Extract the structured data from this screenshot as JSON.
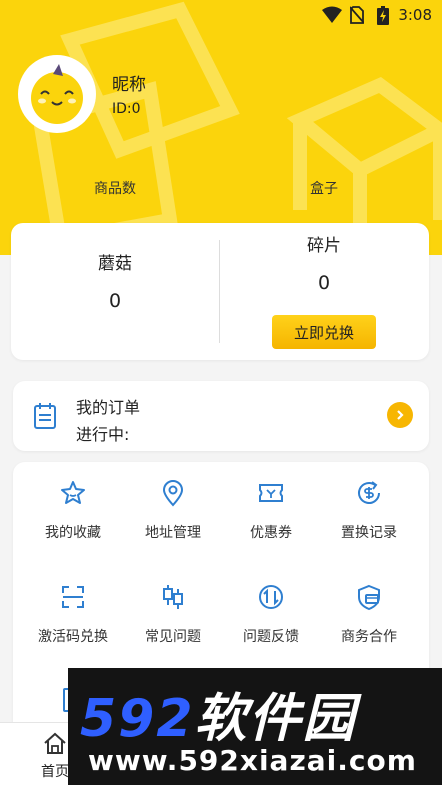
{
  "status_bar": {
    "time": "3:08",
    "icons": [
      "wifi-icon",
      "no-sim-icon",
      "battery-charging-icon"
    ]
  },
  "profile": {
    "nickname": "昵称",
    "id_text": "ID:0"
  },
  "stats": {
    "goods_label": "商品数",
    "box_label": "盒子"
  },
  "points": {
    "mushroom_label": "蘑菇",
    "mushroom_value": "0",
    "fragment_label": "碎片",
    "fragment_value": "0",
    "exchange_label": "立即兑换"
  },
  "order": {
    "title": "我的订单",
    "status": "进行中:"
  },
  "menu": {
    "items": [
      {
        "label": "我的收藏",
        "icon": "star-icon"
      },
      {
        "label": "地址管理",
        "icon": "location-pin-icon"
      },
      {
        "label": "优惠券",
        "icon": "coupon-icon"
      },
      {
        "label": "置换记录",
        "icon": "dollar-exchange-icon"
      },
      {
        "label": "激活码兑换",
        "icon": "scan-icon"
      },
      {
        "label": "常见问题",
        "icon": "candlestick-icon"
      },
      {
        "label": "问题反馈",
        "icon": "swap-arrows-icon"
      },
      {
        "label": "商务合作",
        "icon": "shield-card-icon"
      }
    ]
  },
  "tabbar": {
    "home_label": "首页"
  },
  "watermark": {
    "logo_num": "592",
    "logo_cn": "软件园",
    "url": "www.592xiazai.com"
  },
  "colors": {
    "header_yellow": "#fbd40c",
    "accent_blue": "#2f7fd0",
    "button_yellow": "#f5b400"
  }
}
